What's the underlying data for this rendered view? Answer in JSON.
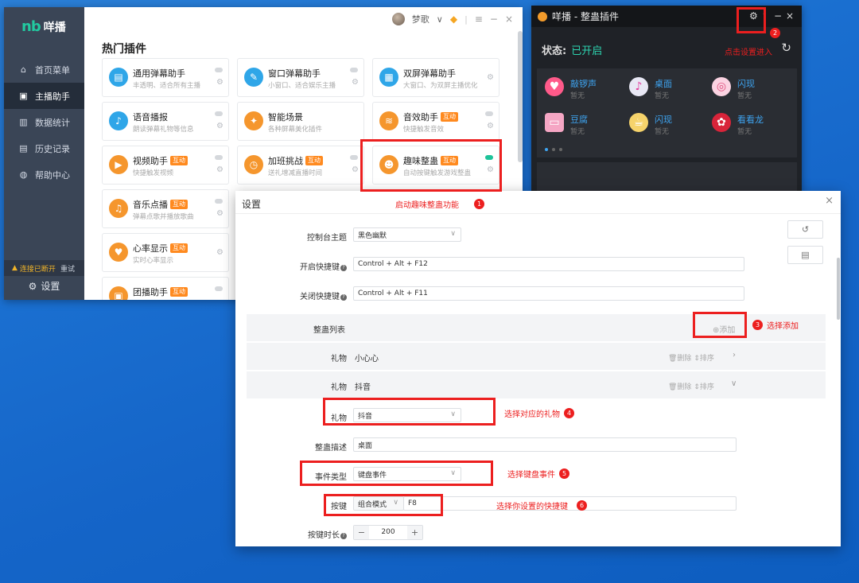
{
  "app": {
    "logo_mark": "nb",
    "logo_text": "咩播",
    "nav": [
      {
        "label": "首页菜单",
        "icon": "home-icon"
      },
      {
        "label": "主播助手",
        "icon": "streamer-icon"
      },
      {
        "label": "数据统计",
        "icon": "chart-icon"
      },
      {
        "label": "历史记录",
        "icon": "history-icon"
      },
      {
        "label": "帮助中心",
        "icon": "help-icon"
      }
    ],
    "disconnected": "连接已断开",
    "retry": "重试",
    "settings_label": "设置",
    "user_name": "梦歌",
    "section_title": "热门插件",
    "plugins": [
      {
        "name": "通用弹幕助手",
        "desc": "丰透明、适合所有主播",
        "tag": ""
      },
      {
        "name": "窗口弹幕助手",
        "desc": "小窗口、适合娱乐主播",
        "tag": ""
      },
      {
        "name": "双屏弹幕助手",
        "desc": "大窗口、为双屏主播优化",
        "tag": ""
      },
      {
        "name": "语音播报",
        "desc": "朗读弹幕礼物等信息",
        "tag": ""
      },
      {
        "name": "智能场景",
        "desc": "各种屏幕美化插件",
        "tag": ""
      },
      {
        "name": "音效助手",
        "desc": "快捷触发音效",
        "tag": "互动"
      },
      {
        "name": "视频助手",
        "desc": "快捷触发视频",
        "tag": "互动"
      },
      {
        "name": "加班挑战",
        "desc": "送礼增减直播时间",
        "tag": "互动"
      },
      {
        "name": "趣味整蛊",
        "desc": "自动按键触发游戏整蛊",
        "tag": "互动"
      },
      {
        "name": "音乐点播",
        "desc": "弹幕点歌并播放歌曲",
        "tag": "互动"
      },
      {
        "name": "心率显示",
        "desc": "实时心率显示",
        "tag": "互动"
      },
      {
        "name": "团播助手",
        "desc": "",
        "tag": "互动"
      }
    ]
  },
  "plugin_window": {
    "title": "咩播 - 整蛊插件",
    "status_label": "状态:",
    "status_value": "已开启",
    "gifts": [
      {
        "name": "敲锣声",
        "sub": "暂无"
      },
      {
        "name": "桌面",
        "sub": "暂无"
      },
      {
        "name": "闪现",
        "sub": "暂无"
      },
      {
        "name": "豆腐",
        "sub": "暂无"
      },
      {
        "name": "闪现",
        "sub": "暂无"
      },
      {
        "name": "看看龙",
        "sub": "暂无"
      }
    ]
  },
  "dialog": {
    "title": "设置",
    "theme_label": "控制台主题",
    "theme_value": "黑色幽默",
    "open_hotkey_label": "开启快捷键",
    "open_hotkey_value": "Control + Alt + F12",
    "close_hotkey_label": "关闭快捷键",
    "close_hotkey_value": "Control + Alt + F11",
    "list_label": "整蛊列表",
    "add_label": "⊕添加",
    "rows": [
      {
        "label": "礼物",
        "value": "小心心",
        "actions": "🗑删除 ⇕排序"
      },
      {
        "label": "礼物",
        "value": "抖音",
        "actions": "🗑删除 ⇕排序"
      }
    ],
    "gift_label": "礼物",
    "gift_value": "抖音",
    "desc_label": "整蛊描述",
    "desc_value": "桌面",
    "event_label": "事件类型",
    "event_value": "键盘事件",
    "key_label": "按键",
    "key_mode": "组合模式",
    "key_value": "F8",
    "duration_label": "按键时长",
    "duration_value": "200",
    "minus": "−",
    "plus": "+"
  },
  "annotations": [
    {
      "num": "1",
      "text": "启动趣味整蛊功能"
    },
    {
      "num": "2",
      "text": "点击设置进入"
    },
    {
      "num": "3",
      "text": "选择添加"
    },
    {
      "num": "4",
      "text": "选择对应的礼物"
    },
    {
      "num": "5",
      "text": "选择键盘事件"
    },
    {
      "num": "6",
      "text": "选择你设置的快捷键"
    }
  ]
}
